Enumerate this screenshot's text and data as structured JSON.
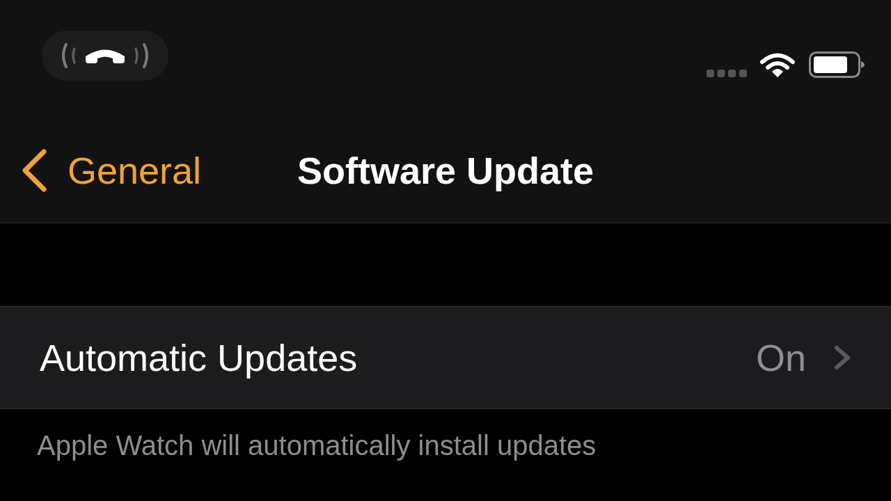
{
  "nav_bar": {
    "back": "General",
    "title": "Software Update"
  },
  "settings": [
    {
      "label": "Automatic Updates",
      "value": "On"
    }
  ],
  "footer": "Apple Watch will automatically install updates"
}
